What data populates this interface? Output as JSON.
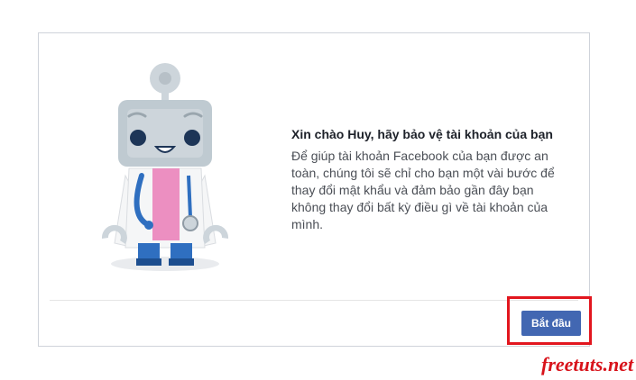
{
  "dialog": {
    "heading": "Xin chào Huy, hãy bảo vệ tài khoản của bạn",
    "body": "Để giúp tài khoản Facebook của bạn được an toàn, chúng tôi sẽ chỉ cho bạn một vài bước để thay đổi mật khẩu và đảm bảo gần đây bạn không thay đổi bất kỳ điều gì về tài khoản của mình.",
    "start_button_label": "Bắt đầu",
    "illustration_icon": "robot-doctor-icon"
  },
  "watermark": "freetuts.net",
  "colors": {
    "button_blue": "#4267b2",
    "highlight_red": "#e2161e",
    "watermark_red": "#d8131b"
  }
}
